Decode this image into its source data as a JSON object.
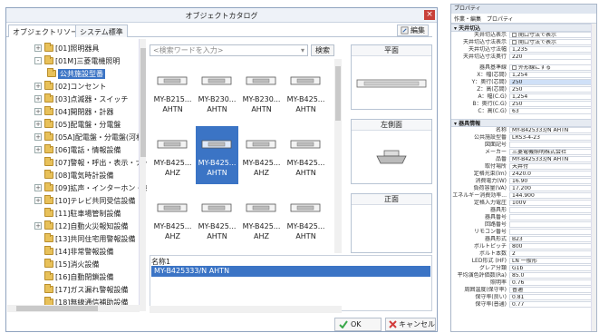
{
  "dialog": {
    "title": "オブジェクトカタログ",
    "close_glyph": "×",
    "tabs": [
      "オブジェクトリソース",
      "システム標準"
    ],
    "edit_label": "編集",
    "search": {
      "placeholder": "<検索ワードを入力>",
      "button": "検索"
    },
    "tree": [
      {
        "label": "[01]照明器具",
        "exp": "+",
        "level": 0
      },
      {
        "label": "[01M]三菱電機照明",
        "exp": "-",
        "level": 0
      },
      {
        "label": "公共施設型番",
        "exp": "",
        "level": 1,
        "selected": true
      },
      {
        "label": "[02]コンセント",
        "exp": "+",
        "level": 0
      },
      {
        "label": "[03]点滅器・スイッチ",
        "exp": "+",
        "level": 0
      },
      {
        "label": "[04]開閉器・計器",
        "exp": "+",
        "level": 0
      },
      {
        "label": "[05]配電盤・分電盤",
        "exp": "+",
        "level": 0
      },
      {
        "label": "[05A]配電盤・分電盤(河村",
        "exp": "+",
        "level": 0
      },
      {
        "label": "[06]電話・情報設備",
        "exp": "+",
        "level": 0
      },
      {
        "label": "[07]警報・呼出・表示・ナー",
        "exp": "",
        "level": 0
      },
      {
        "label": "[08]電気時計設備",
        "exp": "",
        "level": 0
      },
      {
        "label": "[09]拡声・インターホン・映像",
        "exp": "+",
        "level": 0
      },
      {
        "label": "[10]テレビ共同受信設備",
        "exp": "+",
        "level": 0
      },
      {
        "label": "[11]駐車場管制設備",
        "exp": "",
        "level": 0
      },
      {
        "label": "[12]自動火災報知設備",
        "exp": "+",
        "level": 0
      },
      {
        "label": "[13]共同住宅用警報設備",
        "exp": "",
        "level": 0
      },
      {
        "label": "[14]非常警報設備",
        "exp": "",
        "level": 0
      },
      {
        "label": "[15]消火設備",
        "exp": "",
        "level": 0
      },
      {
        "label": "[16]自動閉鎖設備",
        "exp": "",
        "level": 0
      },
      {
        "label": "[17]ガス漏れ警報設備",
        "exp": "",
        "level": 0
      },
      {
        "label": "[18]無線通信補助設備",
        "exp": "",
        "level": 0
      }
    ],
    "grid": [
      {
        "l1": "MY-B215...",
        "l2": "AHTN"
      },
      {
        "l1": "MY-B230...",
        "l2": "AHTN"
      },
      {
        "l1": "MY-B230...",
        "l2": "AHTN"
      },
      {
        "l1": "MY-B425...",
        "l2": "AHTN"
      },
      {
        "l1": "MY-B425...",
        "l2": "AHZ"
      },
      {
        "l1": "MY-B425...",
        "l2": "AHTN",
        "selected": true
      },
      {
        "l1": "MY-B425...",
        "l2": "AHZ"
      },
      {
        "l1": "MY-B425...",
        "l2": "AHTN"
      },
      {
        "l1": "MY-B425...",
        "l2": "AHZ"
      },
      {
        "l1": "MY-B425...",
        "l2": "AHTN"
      },
      {
        "l1": "MY-B425...",
        "l2": "AHZ"
      },
      {
        "l1": "MY-B425...",
        "l2": "AHTN"
      }
    ],
    "panes": {
      "plan": "平面",
      "left_side": "左側面",
      "front": "正面"
    },
    "name_label": "名称1",
    "name_value": "MY-B425333/N AHTN",
    "ok": "OK",
    "cancel": "キャンセル",
    "colors": {
      "selection": "#3b74c5",
      "folder": "#e8c15a",
      "close": "#c8413a",
      "ok_check": "#3aa84a",
      "cancel_x": "#d23c3c"
    }
  },
  "properties": {
    "title": "プロパティ",
    "tabs": [
      "作業・編集",
      "プロパティ"
    ],
    "sec1": "天井切込",
    "display_rows": [
      {
        "k": "天井切込表示",
        "v": "開口寸法で表示",
        "chk": true
      },
      {
        "k": "天井切込寸法表示",
        "v": "開口寸法で表示",
        "chk": true
      },
      {
        "k": "天井切込寸法幅",
        "v": "1,235"
      },
      {
        "k": "天井切込寸法奥行",
        "v": "220"
      }
    ],
    "base_rows": [
      {
        "k": "器具基準線",
        "v": "外形線にする",
        "chk": true
      },
      {
        "k": "X：幅(芯間)",
        "v": "1,254"
      },
      {
        "k": "Y：奥行(芯間)",
        "v": "250",
        "hl": true
      },
      {
        "k": "Z：高(芯間)",
        "v": "250"
      },
      {
        "k": "A：幅(C.G)",
        "v": "1,254"
      },
      {
        "k": "B：奥行(C.G)",
        "v": "250"
      },
      {
        "k": "C：高(C.G)",
        "v": "63"
      }
    ],
    "sec2": "器具情報",
    "info_rows": [
      {
        "k": "名称",
        "v": "MY-B425333/N AHTN"
      },
      {
        "k": "公共施設型番",
        "v": "LRS3-4-23"
      },
      {
        "k": "図面記号",
        "v": ""
      },
      {
        "k": "メーカー",
        "v": "三菱電機照明株式会社"
      },
      {
        "k": "品番",
        "v": "MY-B425333/N AHTN"
      },
      {
        "k": "取付場所",
        "v": "天井付"
      },
      {
        "k": "定格光束(lm)",
        "v": "2420.0"
      },
      {
        "k": "消費電力(W)",
        "v": "16.90"
      },
      {
        "k": "負荷容量(VA)",
        "v": "17.200"
      },
      {
        "k": "エネルギー消費効率...",
        "v": "144.900"
      },
      {
        "k": "定格入力電圧",
        "v": "100V"
      },
      {
        "k": "器具形",
        "v": ""
      },
      {
        "k": "器具番号",
        "v": ""
      },
      {
        "k": "回路番号",
        "v": ""
      },
      {
        "k": "リモコン番号",
        "v": ""
      },
      {
        "k": "器具形式",
        "v": "B23"
      },
      {
        "k": "ボルトピッチ",
        "v": "800"
      },
      {
        "k": "ボルト本数",
        "v": "2"
      },
      {
        "k": "LED形式 (HF)",
        "v": "LN 一般形"
      },
      {
        "k": "グレア分類",
        "v": "G1b"
      },
      {
        "k": "平均演色評価数(Ra)",
        "v": "85.0"
      },
      {
        "k": "照明率",
        "v": "0.76"
      },
      {
        "k": "周囲温度(保守率)",
        "v": "普通"
      },
      {
        "k": "保守率(良い)",
        "v": "0.81"
      },
      {
        "k": "保守率(普通)",
        "v": "0.77"
      }
    ]
  }
}
